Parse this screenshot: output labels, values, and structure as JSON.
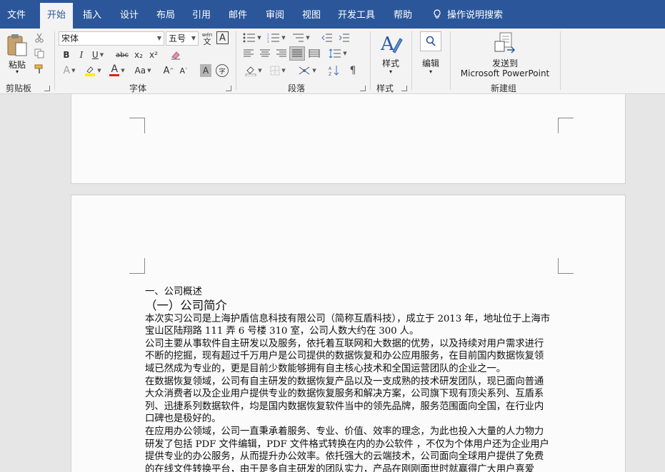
{
  "tabs": [
    {
      "label": "文件"
    },
    {
      "label": "开始"
    },
    {
      "label": "插入"
    },
    {
      "label": "设计"
    },
    {
      "label": "布局"
    },
    {
      "label": "引用"
    },
    {
      "label": "邮件"
    },
    {
      "label": "审阅"
    },
    {
      "label": "视图"
    },
    {
      "label": "开发工具"
    },
    {
      "label": "帮助"
    },
    {
      "label": "操作说明搜索"
    }
  ],
  "ribbon": {
    "clipboard": {
      "paste_label": "粘贴",
      "group_label": "剪贴板"
    },
    "font": {
      "font_name": "宋体",
      "font_size": "五号",
      "bold": "B",
      "italic": "I",
      "underline": "U",
      "strike": "abc",
      "subscript": "x₂",
      "superscript": "x²",
      "font_color_letter": "A",
      "case": "Aa",
      "grow": "A",
      "shrink": "A",
      "char_shade": "A",
      "phonetic": "wén",
      "phonetic_char": "文",
      "enclose": "字",
      "enclosed": "A",
      "group_label": "字体"
    },
    "paragraph": {
      "group_label": "段落"
    },
    "styles": {
      "label": "样式",
      "group_label": "样式"
    },
    "editing": {
      "label": "编辑"
    },
    "send": {
      "line1": "发送到",
      "line2": "Microsoft PowerPoint",
      "group_label": "新建组"
    }
  },
  "document": {
    "heading1": "一、公司概述",
    "heading2": "（一）公司简介",
    "lines": [
      "本次实习公司是上海护盾信息科技有限公司（简称互盾科技），成立于 2013 年，地址位于上海市",
      "宝山区陆翔路 111 弄 6 号楼 310 室，公司人数大约在 300 人。",
      "公司主要从事软件自主研发以及服务，依托着互联网和大数据的优势，以及持续对用户需求进行",
      "不断的挖掘，现有超过千万用户是公司提供的数据恢复和办公应用服务，在目前国内数据恢复领",
      "域已然成为专业的，更是目前少数能够拥有自主核心技术和全国运营团队的企业之一。",
      "在数据恢复领域，公司有自主研发的数据恢复产品以及一支成熟的技术研发团队，现已面向普通",
      "大众消费者以及企业用户提供专业的数据恢复服务和解决方案，公司旗下现有顶尖系列、互盾系",
      "列、迅捷系列数据软件，均是国内数据恢复软件当中的领先品牌，服务范围面向全国，在行业内",
      "口碑也是极好的。",
      "在应用办公领域，公司一直秉承着服务、专业、价值、效率的理念，为此也投入大量的人力物力",
      "研发了包括 PDF 文件编辑，PDF 文件格式转换在内的办公软件 ，不仅为个体用户还为企业用户",
      "提供专业的办公服务，从而提升办公效率。依托强大的云端技术，公司面向全球用户提供了免费",
      "的在线文件转换平台，由于是多自主研发的团队实力，产品在刚刚面世时就赢得广大用户喜爱"
    ]
  }
}
